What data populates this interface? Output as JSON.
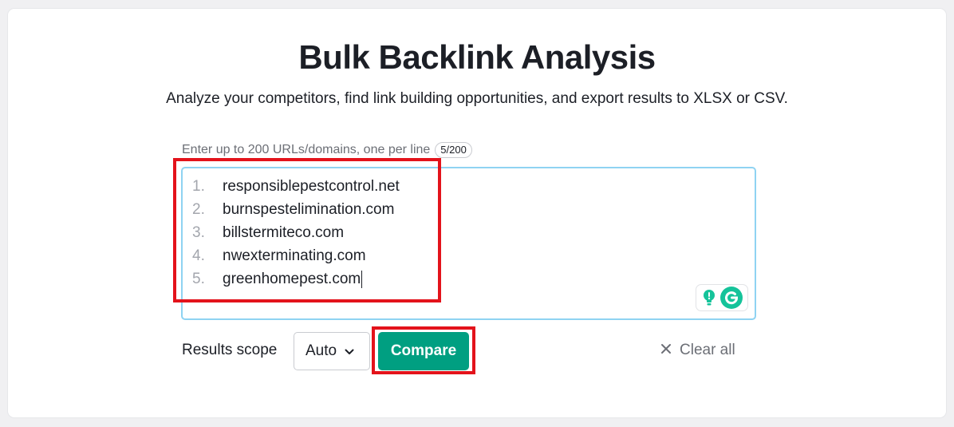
{
  "header": {
    "title": "Bulk Backlink Analysis",
    "subtitle": "Analyze your competitors, find link building opportunities, and export results to XLSX or CSV."
  },
  "input": {
    "label": "Enter up to 200 URLs/domains, one per line",
    "counter": "5/200",
    "lines": [
      {
        "num": "1.",
        "text": "responsiblepestcontrol.net"
      },
      {
        "num": "2.",
        "text": "burnspestelimination.com"
      },
      {
        "num": "3.",
        "text": "billstermiteco.com"
      },
      {
        "num": "4.",
        "text": "nwexterminating.com"
      },
      {
        "num": "5.",
        "text": "greenhomepest.com"
      }
    ]
  },
  "controls": {
    "scope_label": "Results scope",
    "scope_value": "Auto",
    "compare_label": "Compare",
    "clear_label": "Clear all"
  },
  "colors": {
    "accent": "#009f81",
    "highlight": "#e3131b",
    "focus_border": "#8fd3f2"
  },
  "icons": {
    "clear": "close-icon",
    "dropdown": "chevron-down-icon",
    "grammarly_suggest": "lightbulb-icon",
    "grammarly_logo": "grammarly-icon"
  }
}
